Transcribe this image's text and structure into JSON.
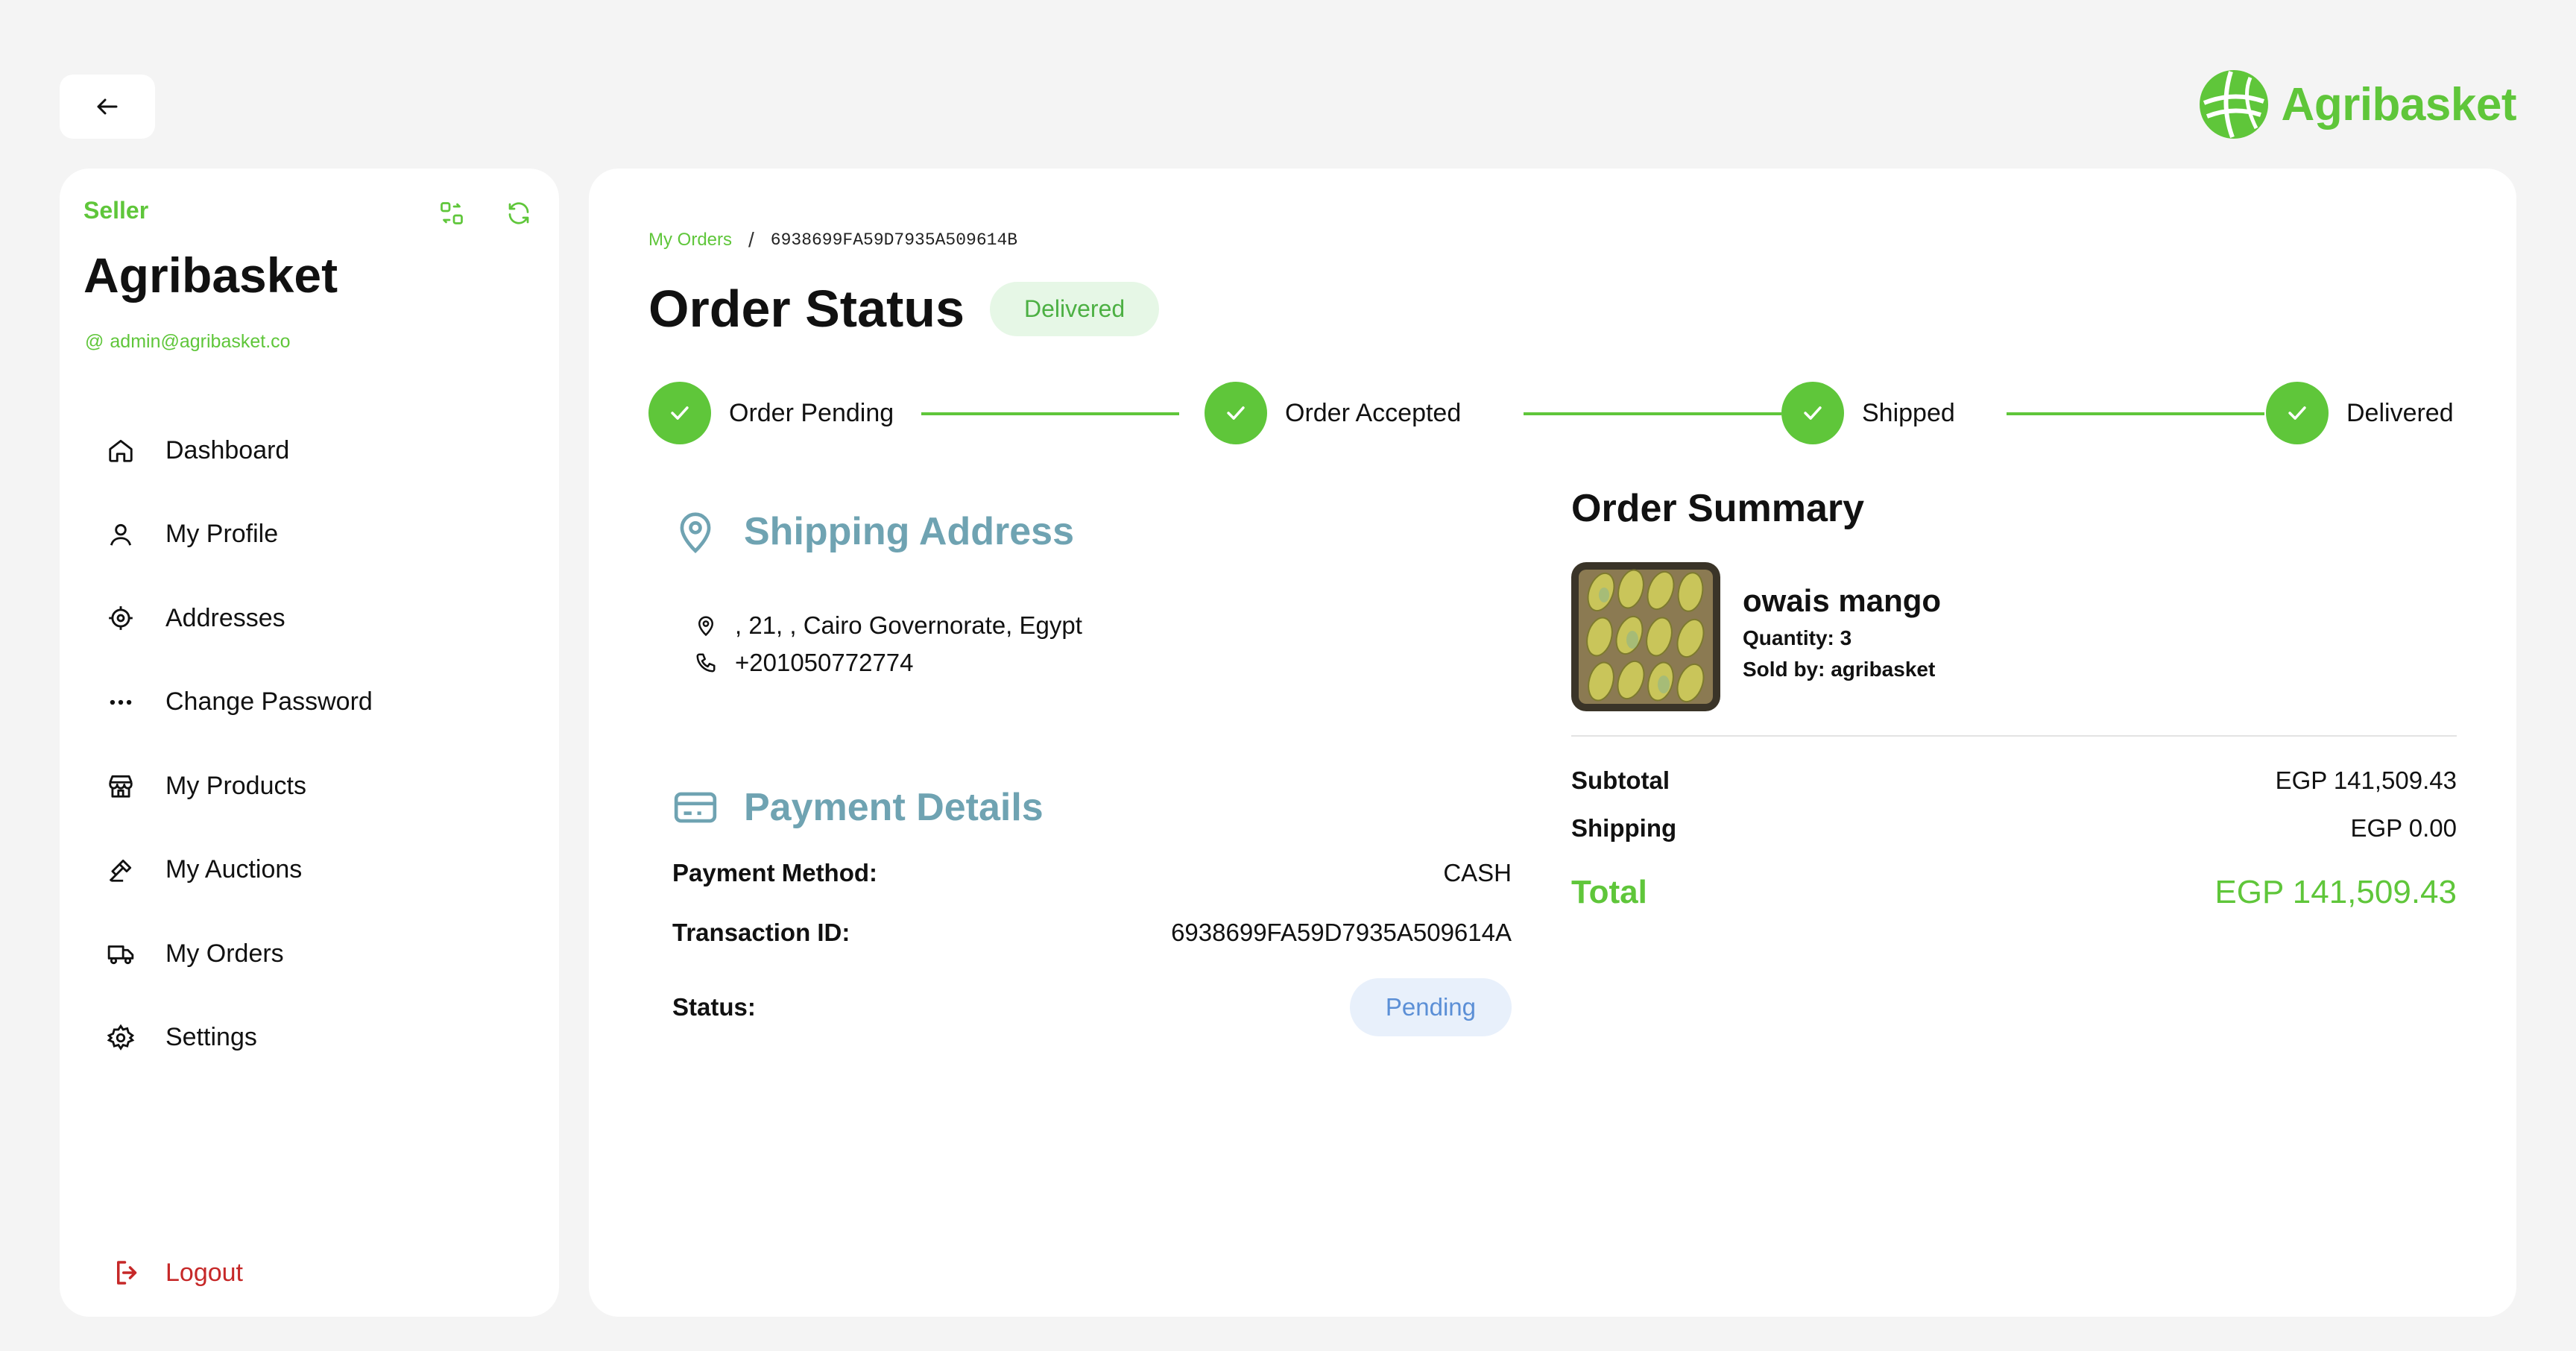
{
  "brand": {
    "name": "Agribasket",
    "accent": "#5fc63a"
  },
  "sidebar": {
    "role": "Seller",
    "name": "Agribasket",
    "email": "admin@agribasket.co",
    "items": [
      {
        "label": "Dashboard",
        "icon": "home-icon"
      },
      {
        "label": "My Profile",
        "icon": "user-icon"
      },
      {
        "label": "Addresses",
        "icon": "location-target-icon"
      },
      {
        "label": "Change Password",
        "icon": "dots-icon"
      },
      {
        "label": "My Products",
        "icon": "store-icon"
      },
      {
        "label": "My Auctions",
        "icon": "gavel-icon"
      },
      {
        "label": "My Orders",
        "icon": "truck-icon"
      },
      {
        "label": "Settings",
        "icon": "gear-icon"
      }
    ],
    "logout_label": "Logout"
  },
  "breadcrumb": {
    "link": "My Orders",
    "separator": "/",
    "current": "6938699FA59D7935A509614B"
  },
  "order": {
    "title": "Order Status",
    "status_badge": "Delivered",
    "steps": [
      "Order Pending",
      "Order Accepted",
      "Shipped",
      "Delivered"
    ]
  },
  "shipping": {
    "title": "Shipping Address",
    "address": ", 21, , Cairo Governorate, Egypt",
    "phone": "+201050772774"
  },
  "payment": {
    "title": "Payment Details",
    "method_label": "Payment Method:",
    "method_value": "CASH",
    "txn_label": "Transaction ID:",
    "txn_value": "6938699FA59D7935A509614A",
    "status_label": "Status:",
    "status_value": "Pending"
  },
  "summary": {
    "title": "Order Summary",
    "product_name": "owais mango",
    "quantity": "Quantity: 3",
    "sold_by": "Sold by: agribasket",
    "subtotal_label": "Subtotal",
    "subtotal_value": "EGP 141,509.43",
    "shipping_label": "Shipping",
    "shipping_value": "EGP 0.00",
    "total_label": "Total",
    "total_value": "EGP 141,509.43"
  }
}
